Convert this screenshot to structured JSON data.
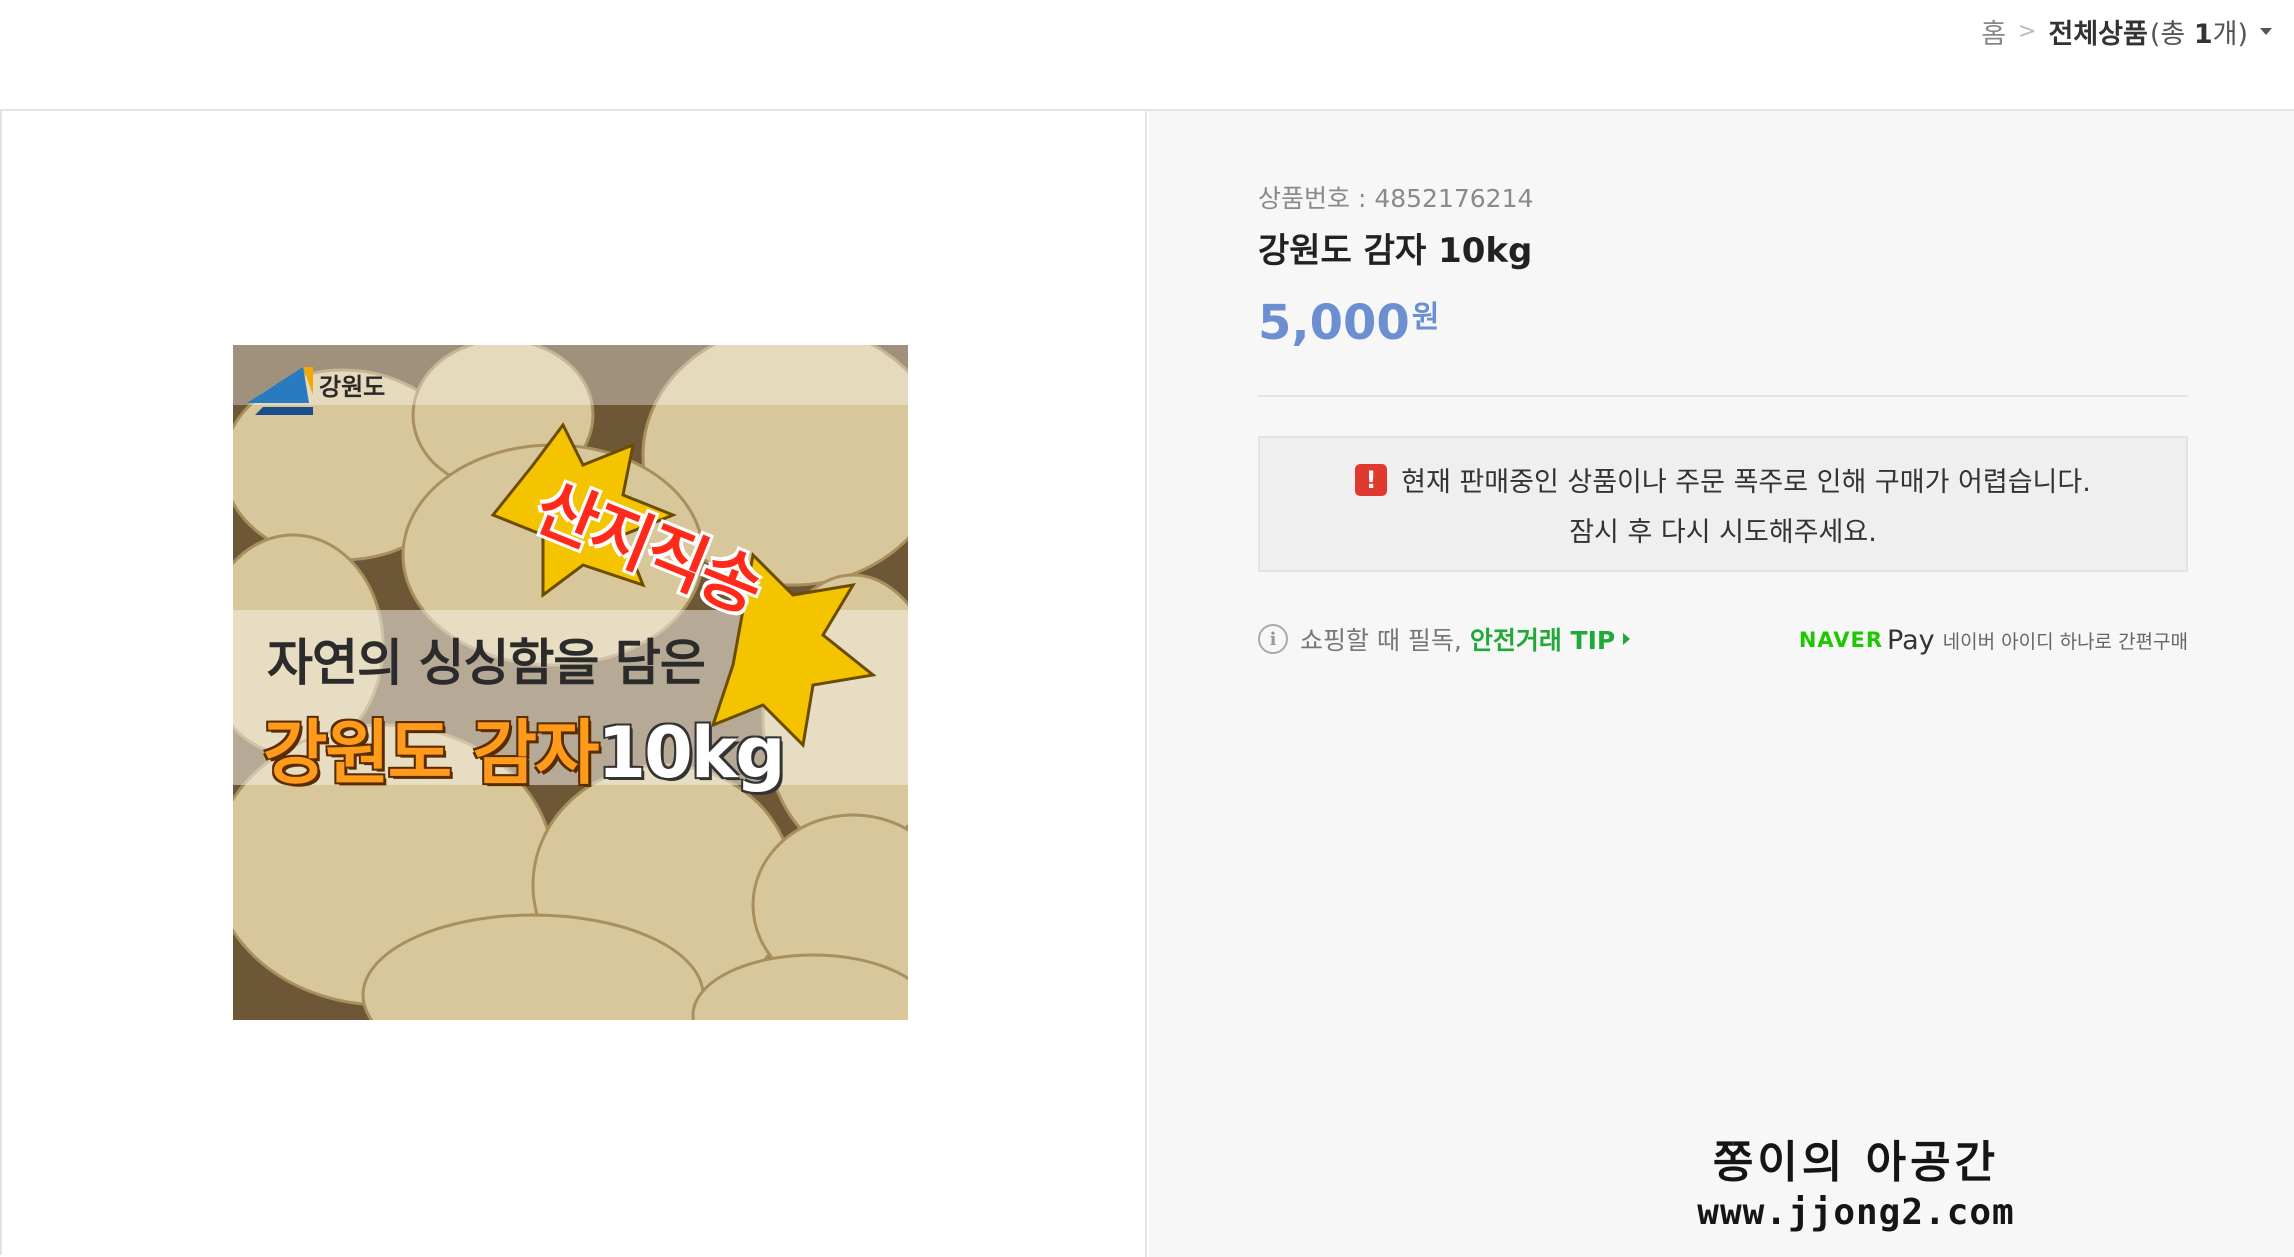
{
  "breadcrumb": {
    "home": "홈",
    "separator": ">",
    "category": "전체상품",
    "count_prefix": "(총 ",
    "count_value": "1",
    "count_suffix": "개)"
  },
  "product": {
    "image": {
      "brand": "강원도",
      "stamp": "산지직송",
      "subtitle": "자연의 싱싱함을 담은",
      "title_main": "강원도 감자",
      "title_weight": "10kg"
    },
    "number_label": "상품번호 : 4852176214",
    "name": "강원도 감자 10kg",
    "price": "5,000",
    "currency": "원"
  },
  "notice": {
    "icon": "!",
    "line1": "현재 판매중인 상품이나 주문 폭주로 인해 구매가 어렵습니다.",
    "line2": "잠시 후 다시 시도해주세요."
  },
  "tip": {
    "text": "쇼핑할 때 필독,",
    "link": "안전거래 TIP"
  },
  "naver_pay": {
    "brand": "NAVER",
    "pay": "Pay",
    "description": "네이버 아이디 하나로 간편구매"
  },
  "watermark": {
    "line1": "쫑이의 아공간",
    "line2": "www.jjong2.com"
  },
  "colors": {
    "price": "#6b8fd0",
    "tip_link": "#20a838",
    "alert": "#e03a2f",
    "naver": "#1ec800",
    "right_panel_bg": "#f7f7f7"
  }
}
